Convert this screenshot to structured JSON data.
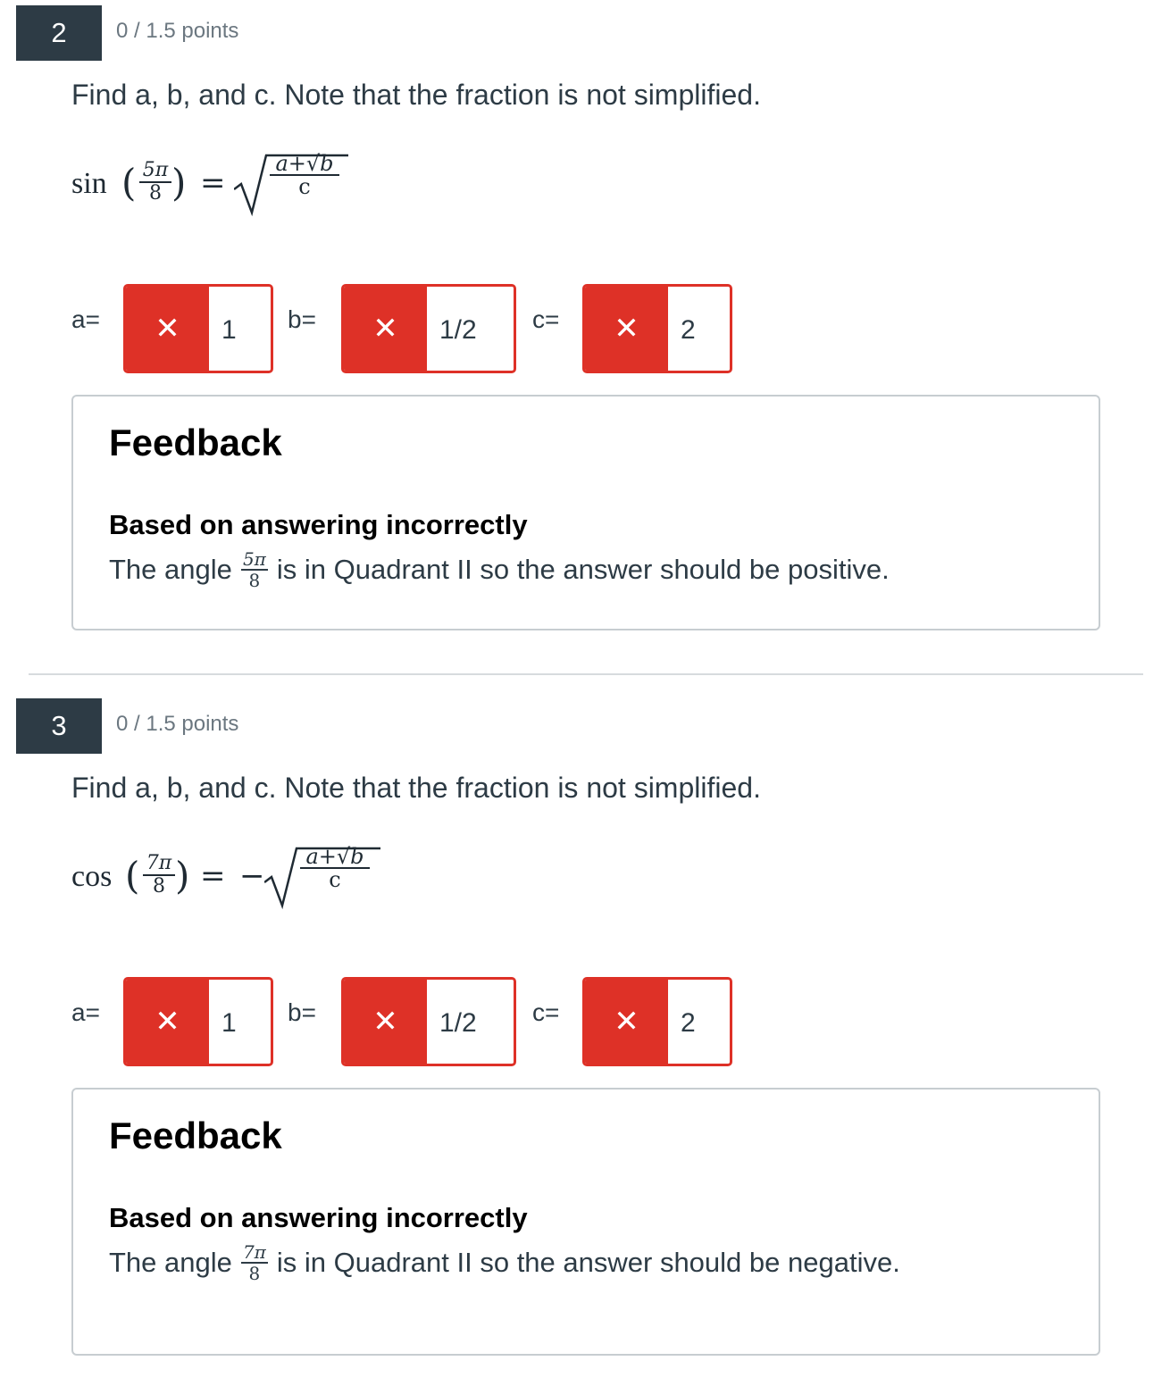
{
  "questions": [
    {
      "number": "2",
      "points": "0 / 1.5 points",
      "prompt": "Find a, b, and c. Note that the fraction is not simplified.",
      "equation": {
        "function": "sin",
        "arg_numerator": "5π",
        "arg_denominator": "8",
        "equals": "=",
        "sign": "",
        "radicand_numerator": "a+√b",
        "radicand_denominator": "c"
      },
      "answers": [
        {
          "label": "a=",
          "value": "1",
          "status_icon": "close-icon",
          "correct": false
        },
        {
          "label": "b=",
          "value": "1/2",
          "status_icon": "close-icon",
          "correct": false
        },
        {
          "label": "c=",
          "value": "2",
          "status_icon": "close-icon",
          "correct": false
        }
      ],
      "feedback": {
        "heading": "Feedback",
        "subheading": "Based on answering incorrectly",
        "text_before": "The angle",
        "angle_numerator": "5π",
        "angle_denominator": "8",
        "text_after": "is in Quadrant II so the answer should be positive."
      }
    },
    {
      "number": "3",
      "points": "0 / 1.5 points",
      "prompt": "Find a, b, and c. Note that the fraction is not simplified.",
      "equation": {
        "function": "cos",
        "arg_numerator": "7π",
        "arg_denominator": "8",
        "equals": "=",
        "sign": "−",
        "radicand_numerator": "a+√b",
        "radicand_denominator": "c"
      },
      "answers": [
        {
          "label": "a=",
          "value": "1",
          "status_icon": "close-icon",
          "correct": false
        },
        {
          "label": "b=",
          "value": "1/2",
          "status_icon": "close-icon",
          "correct": false
        },
        {
          "label": "c=",
          "value": "2",
          "status_icon": "close-icon",
          "correct": false
        }
      ],
      "feedback": {
        "heading": "Feedback",
        "subheading": "Based on answering incorrectly",
        "text_before": "The angle",
        "angle_numerator": "7π",
        "angle_denominator": "8",
        "text_after": "is in Quadrant II so the answer should be negative."
      }
    }
  ],
  "colors": {
    "incorrect": "#de3127",
    "badge": "#2d3b45",
    "text": "#2d3b45",
    "muted": "#6b7780",
    "border": "#c7cdd1"
  }
}
